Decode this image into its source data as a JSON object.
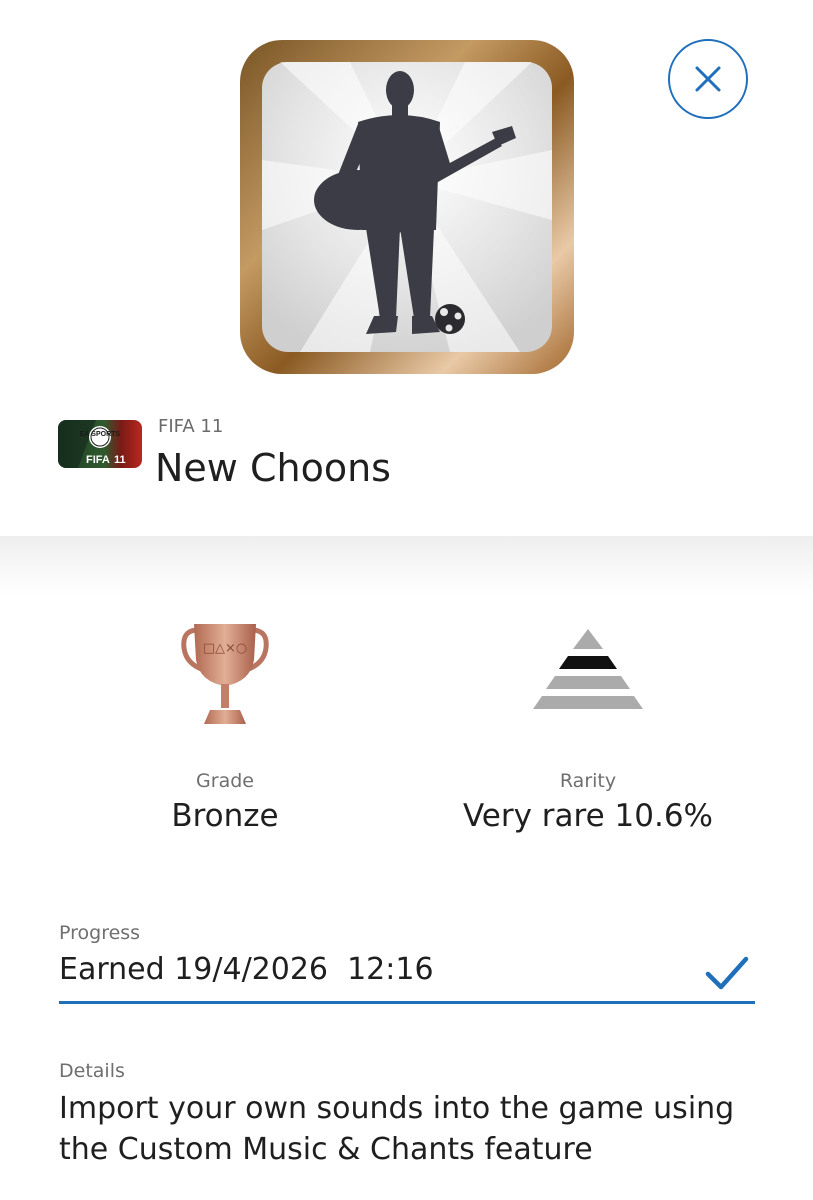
{
  "trophy": {
    "image": "guitar-player-silhouette-with-football",
    "game": "FIFA 11",
    "name": "New Choons"
  },
  "game_icon": {
    "brand": "EA SPORTS",
    "title": "FIFA",
    "edition": "11"
  },
  "close": {
    "icon": "close-icon",
    "color": "#1f6fbd"
  },
  "grade": {
    "label": "Grade",
    "value": "Bronze",
    "icon": "bronze-trophy-icon",
    "cup_symbols": "□△×○",
    "color": "#c98a6e"
  },
  "rarity": {
    "label": "Rarity",
    "value": "Very rare 10.6%",
    "icon": "rarity-pyramid-icon",
    "level": "very-rare",
    "highlighted_tier": 2
  },
  "progress": {
    "label": "Progress",
    "value": "Earned 19/4/2026  12:16",
    "status_icon": "checkmark-icon",
    "accent": "#1f6fbd"
  },
  "details": {
    "label": "Details",
    "text": "Import your own sounds into the game using the Custom Music & Chants feature"
  }
}
